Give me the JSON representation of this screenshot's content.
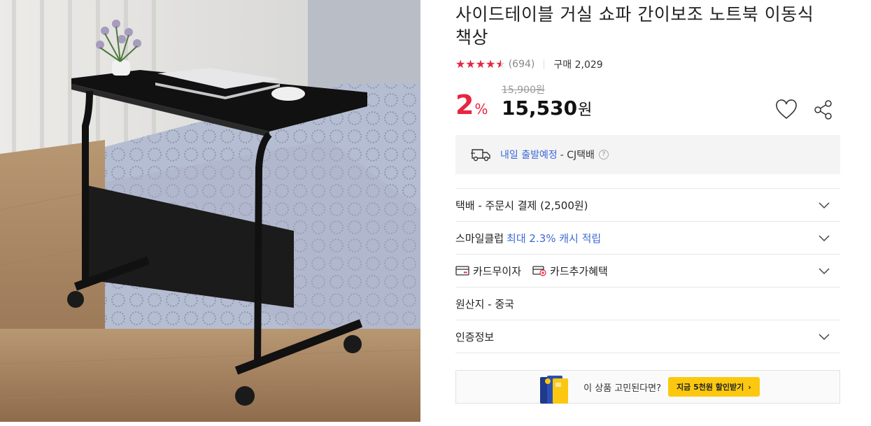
{
  "product": {
    "title": "사이드테이블 거실 쇼파 간이보조 노트북 이동식 책상",
    "rating": 4.5,
    "review_count": "(694)",
    "purchase_count": "구매 2,029"
  },
  "price": {
    "discount_number": "2",
    "discount_unit": "%",
    "original": "15,900원",
    "sale_number": "15,530",
    "sale_unit": "원"
  },
  "shipping": {
    "eta_link": "내일 출발예정",
    "carrier": "- CJ택배",
    "help": "?"
  },
  "rows": {
    "delivery_fee": "택배 - 주문시 결제 (2,500원)",
    "smile_club": "스마일클럽",
    "smile_cash": "최대 2.3% 캐시 적립",
    "card_interest_free": "카드무이자",
    "card_extra_benefit": "카드추가혜택",
    "origin": "원산지 - 중국",
    "certification": "인증정보"
  },
  "banner": {
    "question": "이 상품 고민된다면?",
    "button": "지금 5천원 할인받기",
    "button_arrow": "›"
  },
  "colors": {
    "accent_red": "#e8253f",
    "link_blue": "#3d6ad6",
    "banner_yellow": "#fbc80f"
  }
}
